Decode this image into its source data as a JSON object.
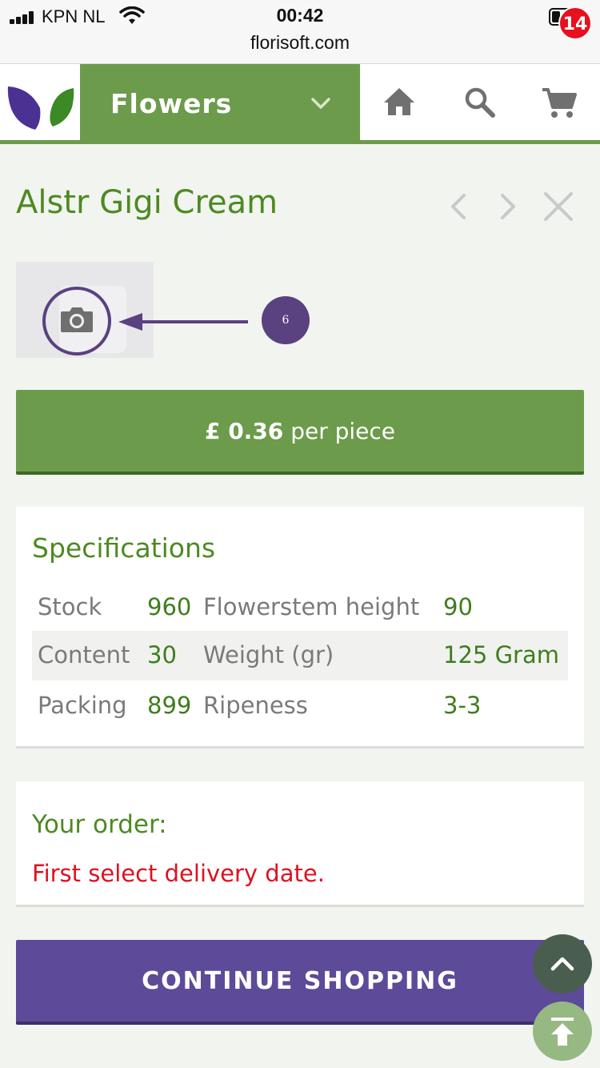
{
  "status_bar": {
    "carrier": "KPN NL",
    "time": "00:42",
    "url": "florisoft.com",
    "battery_level": 0.25,
    "signal_bars": 4
  },
  "header": {
    "category_label": "Flowers",
    "cart_count": "14",
    "icons": [
      "logo-icon",
      "chevron-down-icon",
      "home-icon",
      "search-icon",
      "cart-icon"
    ]
  },
  "product": {
    "title": "Alstr Gigi Cream",
    "annotation_number": "6",
    "price_amount": "£ 0.36",
    "price_unit": "per piece"
  },
  "specifications": {
    "title": "Specifications",
    "rows": [
      {
        "label1": "Stock",
        "value1": "960",
        "label2": "Flowerstem height",
        "value2": "90"
      },
      {
        "label1": "Content",
        "value1": "30",
        "label2": "Weight (gr)",
        "value2": "125 Gram"
      },
      {
        "label1": "Packing",
        "value1": "899",
        "label2": "Ripeness",
        "value2": "3-3"
      }
    ]
  },
  "order": {
    "title": "Your order:",
    "message": "First select delivery date."
  },
  "actions": {
    "continue_label": "CONTINUE SHOPPING"
  },
  "colors": {
    "brand_green": "#6c9b4b",
    "text_green": "#4d8a22",
    "brand_purple": "#5d4a98",
    "error_red": "#e01020",
    "badge_red": "#e8101e"
  }
}
